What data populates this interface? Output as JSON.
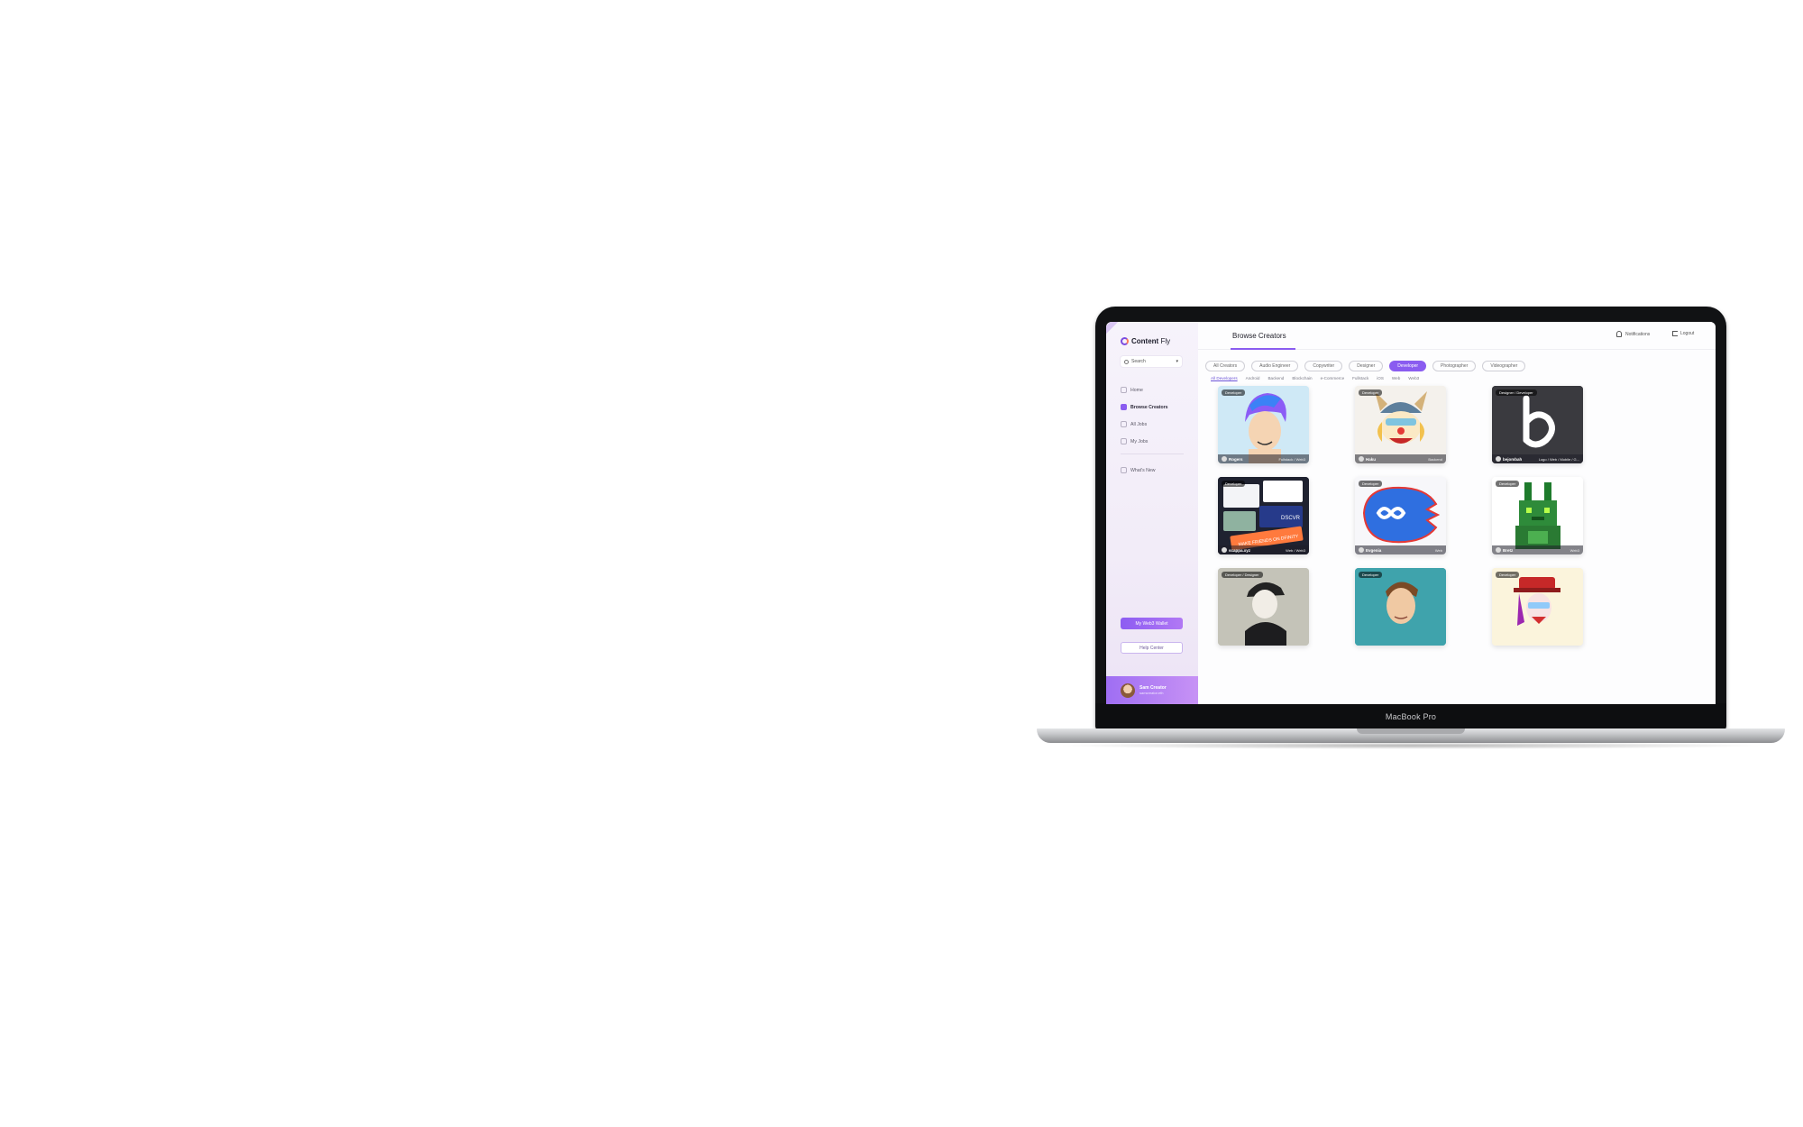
{
  "device": {
    "model_label": "MacBook Pro"
  },
  "sidebar": {
    "brand": {
      "bold": "Content",
      "rest": " Fly"
    },
    "search_label": "Search",
    "items": [
      {
        "label": "Home",
        "icon": "home-icon"
      },
      {
        "label": "Browse Creators",
        "icon": "users-icon",
        "active": true
      },
      {
        "label": "All Jobs",
        "icon": "briefcase-icon"
      },
      {
        "label": "My Jobs",
        "icon": "user-icon"
      }
    ],
    "whats_new": "What's New",
    "wallet_button": "My Web3 Wallet",
    "help_button": "Help Center",
    "profile": {
      "name": "Sam Creator",
      "sub": "samcreator.eth"
    }
  },
  "header": {
    "title": "Browse Creators",
    "notifications": "Notifications",
    "logout": "Logout"
  },
  "categories": [
    "All Creators",
    "Audio Engineer",
    "Copywriter",
    "Designer",
    "Developer",
    "Photographer",
    "Videographer"
  ],
  "active_category": "Developer",
  "subcategories": [
    "All Developers",
    "Android",
    "Backend",
    "Blockchain",
    "e-Commerce",
    "Fullstack",
    "iOS",
    "Web",
    "Web3"
  ],
  "active_subcategory": "All Developers",
  "cards": [
    {
      "tag": "Developer",
      "name": "Rogers",
      "skills": "Fullstack / Web3"
    },
    {
      "tag": "Developer",
      "name": "Haku",
      "skills": "Backend"
    },
    {
      "tag": "Designer / Developer",
      "name": "bejombah",
      "skills": "Logo / Web / Mobile / G..."
    },
    {
      "tag": "Developer",
      "name": "scappa.xyz",
      "skills": "Web / Web3"
    },
    {
      "tag": "Developer",
      "name": "Evgenia",
      "skills": "Web"
    },
    {
      "tag": "Developer",
      "name": "Bretz",
      "skills": "Web3"
    },
    {
      "tag": "Developer / Designer",
      "name": "",
      "skills": ""
    },
    {
      "tag": "Developer",
      "name": "",
      "skills": ""
    },
    {
      "tag": "Developer",
      "name": "",
      "skills": ""
    }
  ],
  "colors": {
    "accent": "#8a5cf0",
    "accent_light": "#c792f5"
  }
}
